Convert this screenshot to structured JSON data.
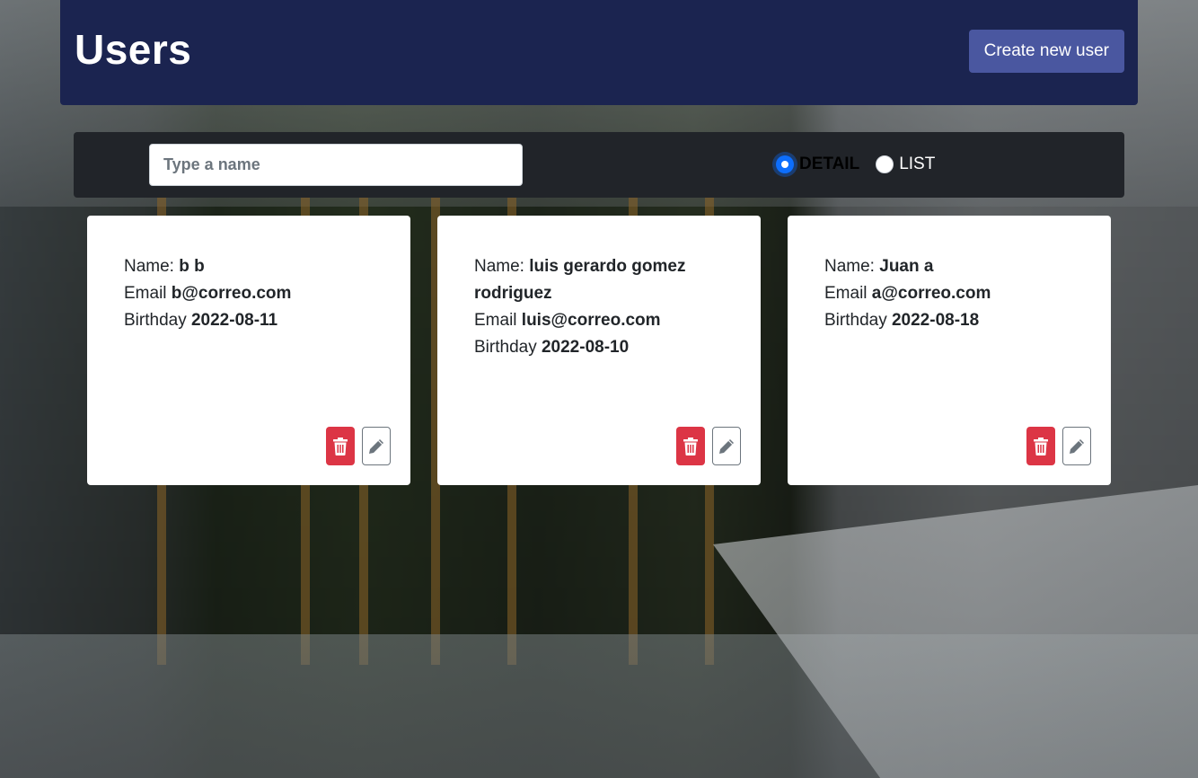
{
  "header": {
    "title": "Users",
    "create_button_label": "Create new user"
  },
  "toolbar": {
    "search_placeholder": "Type a name",
    "search_value": "",
    "view_options": [
      {
        "label": "DETAIL",
        "selected": true
      },
      {
        "label": "LIST",
        "selected": false
      }
    ]
  },
  "field_labels": {
    "name": "Name:",
    "email": "Email",
    "birthday": "Birthday"
  },
  "users": [
    {
      "name": "b b",
      "email": "b@correo.com",
      "birthday": "2022-08-11"
    },
    {
      "name": "luis gerardo gomez rodriguez",
      "email": "luis@correo.com",
      "birthday": "2022-08-10"
    },
    {
      "name": "Juan a",
      "email": "a@correo.com",
      "birthday": "2022-08-18"
    }
  ],
  "icons": {
    "delete": "trash-icon",
    "edit": "pencil-icon"
  },
  "colors": {
    "header_bg": "#1b2450",
    "create_button_bg": "#4a57a0",
    "toolbar_bg": "#212429",
    "delete_button_bg": "#dc3545",
    "radio_selected": "#0d6efd"
  }
}
